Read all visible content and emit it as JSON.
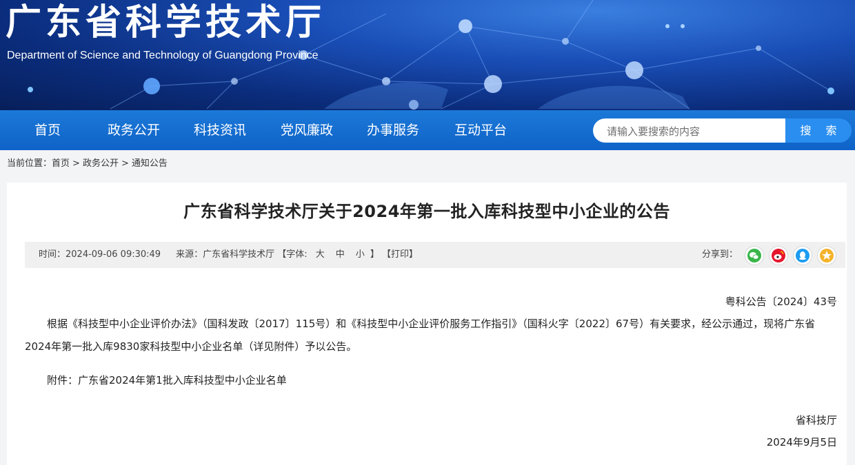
{
  "header": {
    "title": "广东省科学技术厅",
    "subtitle": "Department of Science and Technology of Guangdong Province"
  },
  "nav": {
    "items": [
      {
        "label": "首页"
      },
      {
        "label": "政务公开"
      },
      {
        "label": "科技资讯"
      },
      {
        "label": "党风廉政"
      },
      {
        "label": "办事服务"
      },
      {
        "label": "互动平台"
      }
    ]
  },
  "search": {
    "placeholder": "请输入要搜索的内容",
    "value": "",
    "button_label": "搜 索"
  },
  "breadcrumb": {
    "prefix": "当前位置：",
    "items": [
      "首页",
      "政务公开",
      "通知公告"
    ],
    "separator": ">"
  },
  "article": {
    "title": "广东省科学技术厅关于2024年第一批入库科技型中小企业的公告",
    "meta": {
      "time": "时间：2024-09-06 09:30:49",
      "source": "来源：广东省科学技术厅",
      "font_open": "【字体:",
      "font_large": "大",
      "font_medium": "中",
      "font_small": "小",
      "font_close": "】",
      "print": "【打印】",
      "share_label": "分享到："
    },
    "share_icons": [
      "wechat-icon",
      "weibo-icon",
      "qq-icon",
      "qzone-icon"
    ],
    "doc_number": "粤科公告〔2024〕43号",
    "paragraph": "根据《科技型中小企业评价办法》（国科发政〔2017〕115号）和《科技型中小企业评价服务工作指引》（国科火字〔2022〕67号）有关要求，经公示通过，现将广东省2024年第一批入库9830家科技型中小企业名单（详见附件）予以公告。",
    "attachment": "附件：广东省2024年第1批入库科技型中小企业名单",
    "sign_org": "省科技厅",
    "sign_date": "2024年9月5日"
  },
  "colors": {
    "nav_bg": "#1468cc",
    "search_button": "#2a8ef0",
    "banner_dark": "#0b2d7d",
    "meta_bg": "#f0f0f0",
    "wechat": "#3ab54a",
    "weibo": "#e6162d",
    "qq": "#1b9cf2",
    "qzone": "#f5b22b"
  }
}
